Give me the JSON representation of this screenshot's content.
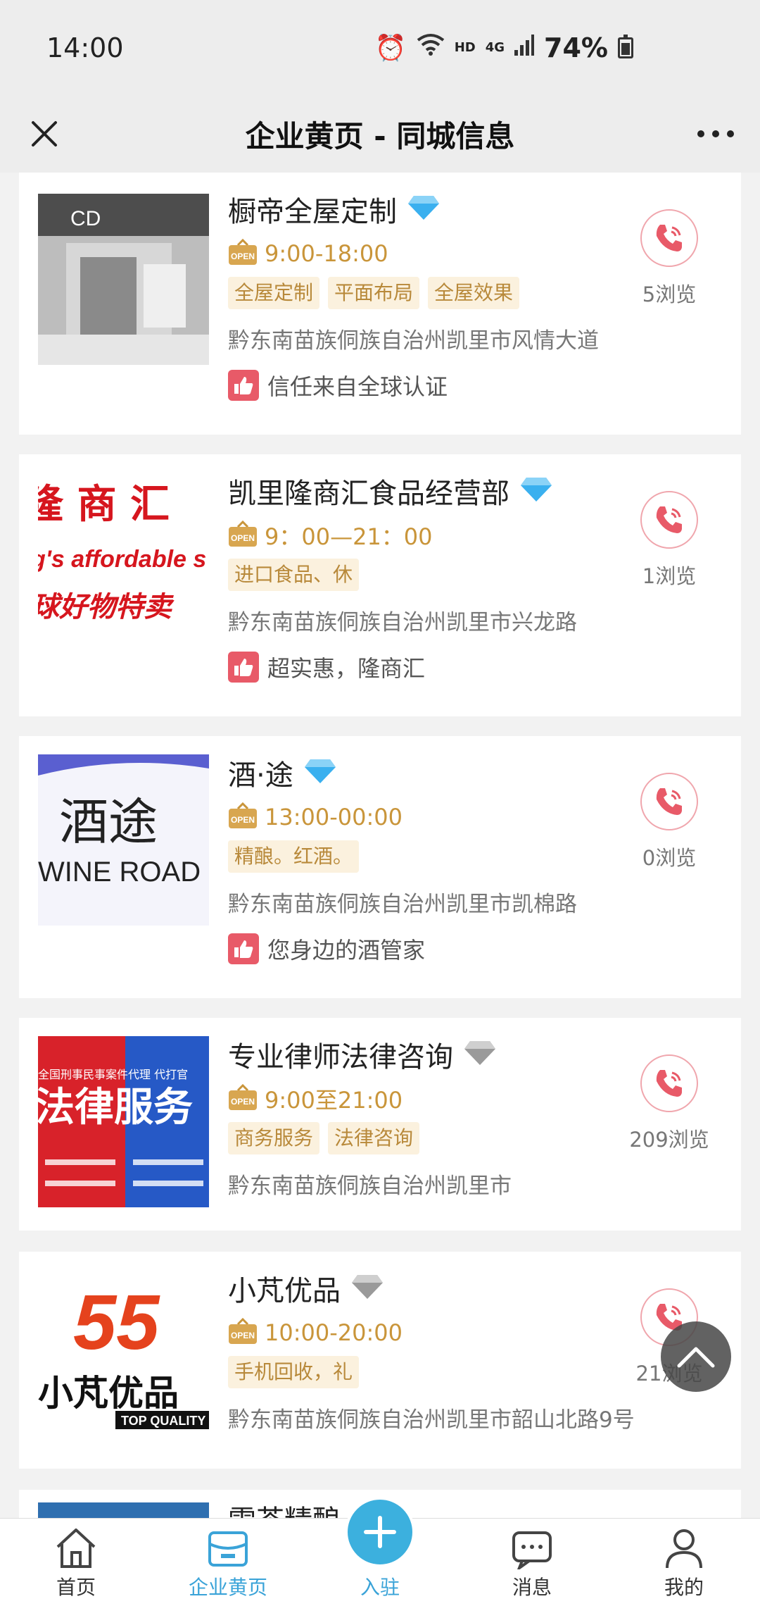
{
  "status": {
    "time": "14:00",
    "network": "HD",
    "signal": "4G",
    "battery": "74%"
  },
  "header": {
    "title": "企业黄页 - 同城信息",
    "close_icon": "close-icon",
    "more_icon": "more-icon"
  },
  "listings": [
    {
      "name": "橱帝全屋定制",
      "badge": "blue-diamond",
      "hours": "9:00-18:00",
      "tags": [
        "全屋定制",
        "平面布局",
        "全屋效果"
      ],
      "address": "黔东南苗族侗族自治州凯里市风情大道",
      "slogan": "信任来自全球认证",
      "views": "5浏览",
      "image_text": "CD"
    },
    {
      "name": "凯里隆商汇食品经营部",
      "badge": "blue-diamond",
      "hours": "9：00—21：00",
      "tags": [
        "进口食品、休"
      ],
      "address": "黔东南苗族侗族自治州凯里市兴龙路",
      "slogan": "超实惠，隆商汇",
      "views": "1浏览",
      "image_text_1": "隆 商 汇",
      "image_text_2": "g's affordable s",
      "image_text_3": "球好物特卖"
    },
    {
      "name": "酒·途",
      "badge": "blue-diamond",
      "hours": "13:00-00:00",
      "tags": [
        "精酿。红酒。"
      ],
      "address": "黔东南苗族侗族自治州凯里市凯棉路",
      "slogan": "您身边的酒管家",
      "views": "0浏览",
      "image_text_1": "酒途",
      "image_text_2": "WINE ROAD"
    },
    {
      "name": "专业律师法律咨询",
      "badge": "gray-diamond",
      "hours": "9:00至21:00",
      "tags": [
        "商务服务",
        "法律咨询"
      ],
      "address": "黔东南苗族侗族自治州凯里市",
      "slogan": "",
      "views": "209浏览",
      "image_text_1": "全国刑事民事案件代理 代打官",
      "image_text_2": "法律服务"
    },
    {
      "name": "小芃优品",
      "badge": "gray-diamond",
      "hours": "10:00-20:00",
      "tags": [
        "手机回收，礼"
      ],
      "address": "黔东南苗族侗族自治州凯里市韶山北路9号",
      "slogan": "",
      "views": "21浏览",
      "image_text_1": "55",
      "image_text_2": "小芃优品",
      "image_text_3": "TOP QUALITY"
    },
    {
      "name": "雪茶精酿",
      "badge": "gray-diamond",
      "hours": "",
      "tags": [],
      "address": "",
      "slogan": "",
      "views": ""
    }
  ],
  "open_badge": "OPEN",
  "tabs": [
    {
      "label": "首页",
      "icon": "home-icon"
    },
    {
      "label": "企业黄页",
      "icon": "yellowpage-icon",
      "active": true
    },
    {
      "label": "入驻",
      "icon": "plus-icon"
    },
    {
      "label": "消息",
      "icon": "message-icon"
    },
    {
      "label": "我的",
      "icon": "user-icon"
    }
  ],
  "colors": {
    "accent": "#3aa3d8",
    "hours": "#c9953a",
    "tag_bg": "#fbf1de",
    "phone": "#e85a68"
  }
}
